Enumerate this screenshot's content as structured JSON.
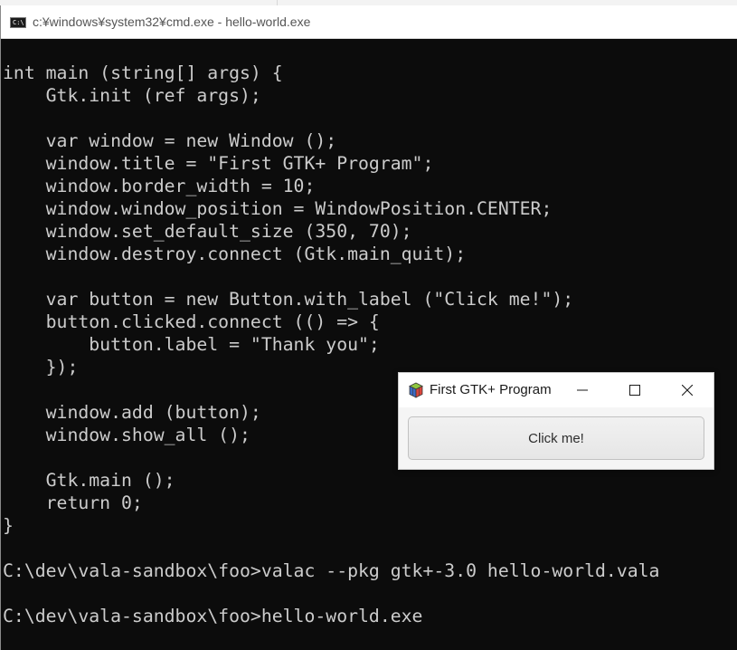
{
  "console_window": {
    "title": "c:¥windows¥system32¥cmd.exe - hello-world.exe",
    "icon": "cmd-console-icon",
    "icon_text": "C:\\",
    "lines": [
      "int main (string[] args) {",
      "    Gtk.init (ref args);",
      "",
      "    var window = new Window ();",
      "    window.title = \"First GTK+ Program\";",
      "    window.border_width = 10;",
      "    window.window_position = WindowPosition.CENTER;",
      "    window.set_default_size (350, 70);",
      "    window.destroy.connect (Gtk.main_quit);",
      "",
      "    var button = new Button.with_label (\"Click me!\");",
      "    button.clicked.connect (() => {",
      "        button.label = \"Thank you\";",
      "    });",
      "",
      "    window.add (button);",
      "    window.show_all ();",
      "",
      "    Gtk.main ();",
      "    return 0;",
      "}",
      "",
      "C:\\dev\\vala-sandbox\\foo>valac --pkg gtk+-3.0 hello-world.vala",
      "",
      "C:\\dev\\vala-sandbox\\foo>hello-world.exe"
    ]
  },
  "gtk_window": {
    "title": "First GTK+ Program",
    "icon": "gtk-cube-icon",
    "button_label": "Click me!",
    "controls": [
      "minimize-icon",
      "maximize-icon",
      "close-icon"
    ]
  },
  "colors": {
    "console_bg": "#0c0c0c",
    "console_fg": "#cccccc"
  }
}
